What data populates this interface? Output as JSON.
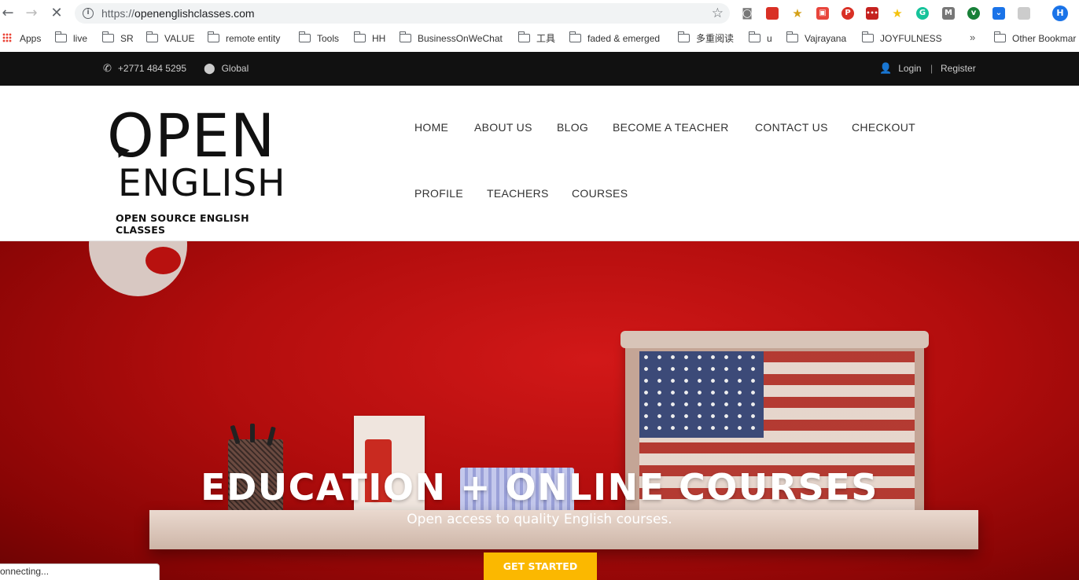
{
  "browser": {
    "url_protocol": "https://",
    "url_host": "openenglishclasses.com",
    "profile_initial": "H",
    "status_text": "onnecting..."
  },
  "bookmarks": {
    "apps_label": "Apps",
    "items": [
      "live",
      "SR",
      "VALUE",
      "remote entity",
      "Tools",
      "HH",
      "BusinessOnWeChat",
      "工具",
      "faded & emerged",
      "多重阅读",
      "u",
      "Vajrayana",
      "JOYFULNESS"
    ],
    "overflow": "»",
    "other_label": "Other Bookmar"
  },
  "topbar": {
    "phone": "+2771 484 5295",
    "location": "Global",
    "login": "Login",
    "separator": "|",
    "register": "Register"
  },
  "logo": {
    "line1": "OPEN",
    "line2": "ENGLISH",
    "tagline": "OPEN SOURCE ENGLISH CLASSES"
  },
  "menu": {
    "row1": [
      "HOME",
      "ABOUT US",
      "BLOG",
      "BECOME A TEACHER",
      "CONTACT US",
      "CHECKOUT"
    ],
    "row2": [
      "PROFILE",
      "TEACHERS",
      "COURSES"
    ]
  },
  "hero": {
    "title": "EDUCATION + ONLINE COURSES",
    "subtitle": "Open access to quality English courses.",
    "cta": "GET STARTED"
  },
  "colors": {
    "hero_red": "#b20d0d",
    "cta_yellow": "#fbb800",
    "topbar_black": "#111111"
  }
}
